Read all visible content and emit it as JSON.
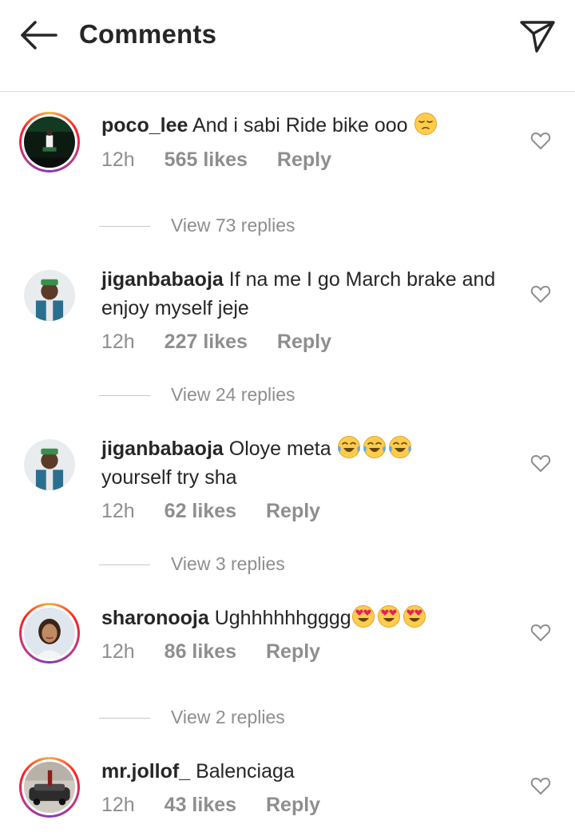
{
  "header": {
    "title": "Comments",
    "back_icon": "back-arrow-icon",
    "share_icon": "send-icon"
  },
  "comments": [
    {
      "username": "poco_lee",
      "text": "And i sabi Ride bike ooo",
      "emoji": [
        "pensive-face"
      ],
      "time": "12h",
      "likes": "565 likes",
      "reply": "Reply",
      "view_replies": "View 73 replies"
    },
    {
      "username": "jiganbabaoja",
      "text": "If na me I go March brake and enjoy myself jeje",
      "emoji": [],
      "time": "12h",
      "likes": "227 likes",
      "reply": "Reply",
      "view_replies": "View 24 replies"
    },
    {
      "username": "jiganbabaoja",
      "text": "Oloye meta",
      "text_after": "yourself try sha",
      "emoji": [
        "tears-of-joy",
        "tears-of-joy",
        "tears-of-joy"
      ],
      "time": "12h",
      "likes": "62 likes",
      "reply": "Reply",
      "view_replies": "View 3 replies"
    },
    {
      "username": "sharonooja",
      "text": "Ughhhhhhgggg",
      "emoji": [
        "heart-eyes",
        "heart-eyes",
        "heart-eyes"
      ],
      "time": "12h",
      "likes": "86 likes",
      "reply": "Reply",
      "view_replies": "View 2 replies"
    },
    {
      "username": "mr.jollof_",
      "text": "Balenciaga",
      "emoji": [],
      "time": "12h",
      "likes": "43 likes",
      "reply": "Reply"
    }
  ],
  "colors": {
    "text": "#262626",
    "muted": "#8e8e8e",
    "divider": "#dbdbdb"
  }
}
